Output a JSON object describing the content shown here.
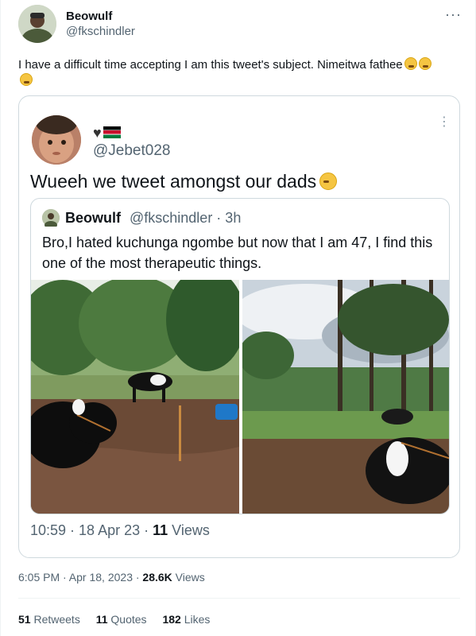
{
  "tweet": {
    "author_name": "Beowulf",
    "author_handle": "@fkschindler",
    "text": "I have a difficult time accepting I am this tweet's subject. Nimeitwa fathee",
    "emoji": [
      "weary-face-emoji",
      "weary-face-emoji",
      "weary-face-emoji"
    ],
    "more_label": "···",
    "timestamp": "6:05 PM · Apr 18, 2023 · ",
    "views_count": "28.6K",
    "views_label": " Views",
    "stats": {
      "retweets_count": "51",
      "retweets_label": " Retweets",
      "quotes_count": "11",
      "quotes_label": " Quotes",
      "likes_count": "182",
      "likes_label": " Likes"
    }
  },
  "quote": {
    "handle": "@Jebet028",
    "badges": [
      "black-heart",
      "kenya-flag"
    ],
    "text": "Wueeh we tweet amongst our dads",
    "emoji": "pleading-face-emoji",
    "more_label": "⋮",
    "time": "10:59 · 18 Apr 23 · ",
    "views_count": "11",
    "views_label": " Views"
  },
  "inner_quote": {
    "author_name": "Beowulf",
    "author_handle": "@fkschindler · 3h",
    "text": "Bro,I hated kuchunga ngombe but now that I am 47, I find this one of the most therapeutic things.",
    "images": [
      "cows-in-farm-yard-photo",
      "cow-resting-in-field-photo"
    ]
  },
  "colors": {
    "text_primary": "#0f1419",
    "text_secondary": "#536471",
    "border": "#cfd9de"
  }
}
